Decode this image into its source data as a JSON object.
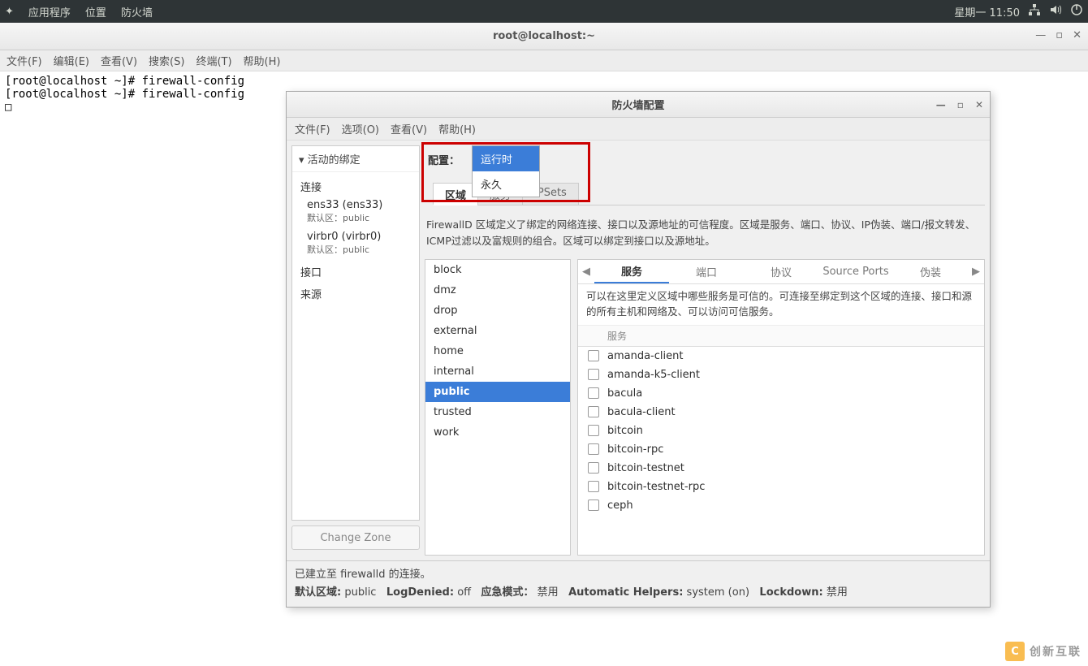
{
  "top_panel": {
    "apps": "应用程序",
    "places": "位置",
    "firewall": "防火墙",
    "clock": "星期一   11:50"
  },
  "terminal": {
    "title": "root@localhost:~",
    "menu": {
      "file": "文件(F)",
      "edit": "编辑(E)",
      "view": "查看(V)",
      "search": "搜索(S)",
      "terminal": "终端(T)",
      "help": "帮助(H)"
    },
    "lines": [
      "[root@localhost ~]# firewall-config",
      "[root@localhost ~]# firewall-config",
      "□"
    ]
  },
  "dialog": {
    "title": "防火墙配置",
    "menu": {
      "file": "文件(F)",
      "options": "选项(O)",
      "view": "查看(V)",
      "help": "帮助(H)"
    },
    "active_bindings_header": "活动的绑定",
    "bindings": {
      "conn_label": "连接",
      "ifaces": [
        {
          "name": "ens33 (ens33)",
          "sub": "默认区：public"
        },
        {
          "name": "virbr0 (virbr0)",
          "sub": "默认区：public"
        }
      ],
      "iface_label": "接口",
      "source_label": "来源"
    },
    "change_zone": "Change Zone",
    "config_label": "配置：",
    "config_options": {
      "runtime": "运行时",
      "permanent": "永久"
    },
    "main_tabs": {
      "zone": "区域",
      "service": "服务",
      "ipsets": "IPSets"
    },
    "zone_desc": "FirewallD 区域定义了绑定的网络连接、接口以及源地址的可信程度。区域是服务、端口、协议、IP伪装、端口/报文转发、ICMP过滤以及富规则的组合。区域可以绑定到接口以及源地址。",
    "zones": [
      "block",
      "dmz",
      "drop",
      "external",
      "home",
      "internal",
      "public",
      "trusted",
      "work"
    ],
    "zones_selected": "public",
    "svc_tabs": {
      "service": "服务",
      "port": "端口",
      "proto": "协议",
      "srcport": "Source Ports",
      "masq": "伪装"
    },
    "svc_desc": "可以在这里定义区域中哪些服务是可信的。可连接至绑定到这个区域的连接、接口和源的所有主机和网络及、可以访问可信服务。",
    "svc_col": "服务",
    "services": [
      "amanda-client",
      "amanda-k5-client",
      "bacula",
      "bacula-client",
      "bitcoin",
      "bitcoin-rpc",
      "bitcoin-testnet",
      "bitcoin-testnet-rpc",
      "ceph"
    ],
    "status_line": "已建立至  firewalld 的连接。",
    "footer": {
      "default_zone_l": "默认区域:",
      "default_zone_v": "public",
      "logdenied_l": "LogDenied:",
      "logdenied_v": "off",
      "panic_l": "应急模式：",
      "panic_v": "禁用",
      "autohelpers_l": "Automatic Helpers:",
      "autohelpers_v": "system (on)",
      "lockdown_l": "Lockdown:",
      "lockdown_v": "禁用"
    }
  },
  "watermark": "创新互联"
}
